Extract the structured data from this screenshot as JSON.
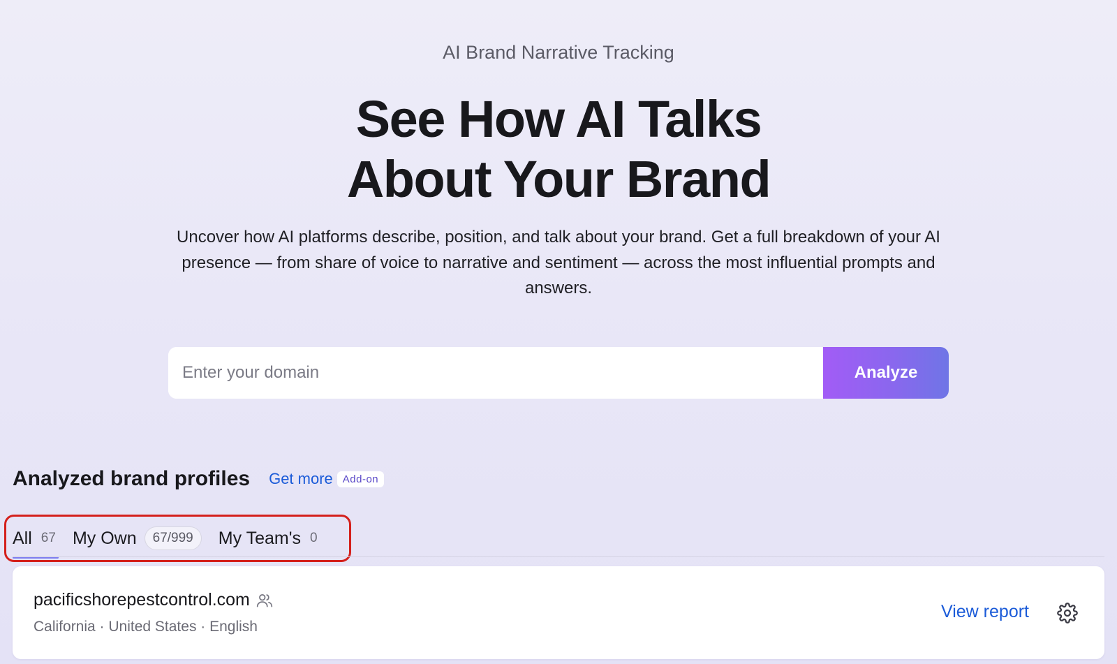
{
  "hero": {
    "eyebrow": "AI Brand Narrative Tracking",
    "title_line1": "See How AI Talks",
    "title_line2": "About Your Brand",
    "subtitle": "Uncover how AI platforms describe, position, and talk about your brand. Get a full breakdown of your AI presence — from share of voice to narrative and sentiment — across the most influential prompts and answers."
  },
  "search": {
    "placeholder": "Enter your domain",
    "value": "",
    "button_label": "Analyze"
  },
  "profiles": {
    "title": "Analyzed brand profiles",
    "get_more_label": "Get more",
    "addon_badge": "Add-on",
    "tabs": [
      {
        "label": "All",
        "count": "67",
        "active": true
      },
      {
        "label": "My Own",
        "count": "67/999",
        "active": false
      },
      {
        "label": "My Team's",
        "count": "0",
        "active": false
      }
    ],
    "items": [
      {
        "domain": "pacificshorepestcontrol.com",
        "meta": "California · United States · English",
        "action_label": "View report"
      }
    ]
  },
  "colors": {
    "accent_blue": "#1b5bd8",
    "analyze_gradient_start": "#a25cf6",
    "analyze_gradient_end": "#6f75e6",
    "highlight_red": "#d4201c",
    "active_tab_underline": "#7d7ef0"
  }
}
